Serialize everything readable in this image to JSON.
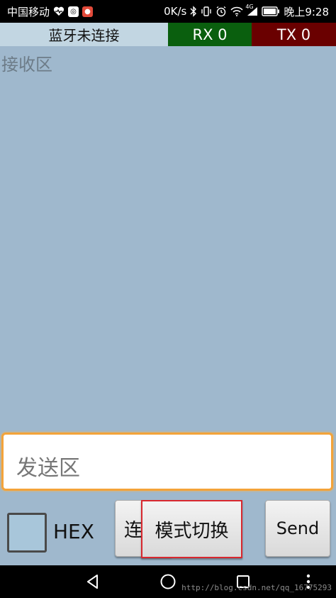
{
  "statusbar": {
    "carrier": "中国移动",
    "speed": "0K/s",
    "network": "4G",
    "time": "晚上9:28",
    "icons": [
      "heart-icon",
      "app-icon",
      "map-icon",
      "bluetooth-icon",
      "vibrate-icon",
      "alarm-icon",
      "wifi-icon",
      "signal-icon",
      "battery-icon"
    ]
  },
  "header": {
    "bt_status": "蓝牙未连接",
    "rx": "RX 0",
    "tx": "TX 0",
    "rx_color": "#0a5f0e",
    "tx_color": "#6a0000"
  },
  "receive": {
    "label": "接收区"
  },
  "send": {
    "placeholder": "发送区",
    "accent": "#f3a33a"
  },
  "controls": {
    "hex_label": "HEX",
    "hex_checked": false,
    "connect_label": "连接",
    "mode_label": "模式切换",
    "send_label": "Send"
  },
  "navbar": {
    "icons": [
      "back-icon",
      "home-icon",
      "recents-icon",
      "menu-dots-icon"
    ],
    "watermark": "http://blog.csdn.net/qq_16775293"
  }
}
